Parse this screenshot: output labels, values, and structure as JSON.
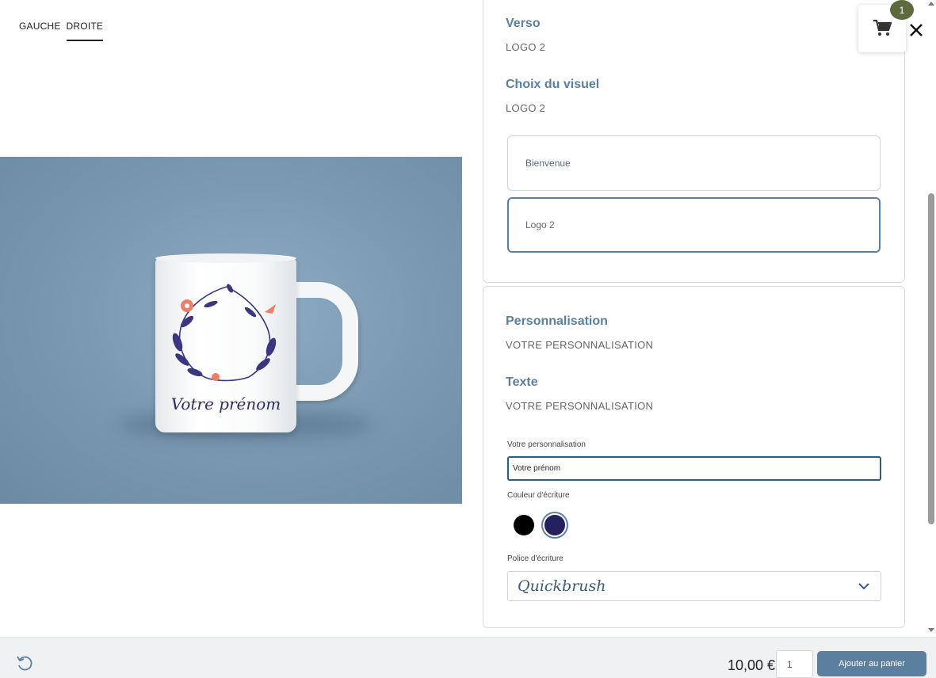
{
  "preview": {
    "tabs": [
      {
        "label": "GAUCHE",
        "active": false
      },
      {
        "label": "DROITE",
        "active": true
      }
    ],
    "mug_text": "Votre prénom",
    "background_color": "#7897b0"
  },
  "verso": {
    "title": "Verso",
    "value": "LOGO 2"
  },
  "visual": {
    "title": "Choix du visuel",
    "value": "LOGO 2",
    "options": [
      {
        "label": "Bienvenue",
        "selected": false
      },
      {
        "label": "Logo 2",
        "selected": true
      }
    ]
  },
  "personalisation": {
    "title": "Personnalisation",
    "value": "VOTRE PERSONNALISATION"
  },
  "text": {
    "title": "Texte",
    "value": "VOTRE PERSONNALISATION",
    "input_label": "Votre personnalisation",
    "input_value": "Votre prénom",
    "color_label": "Couleur d'écriture",
    "colors": [
      {
        "name": "black",
        "hex": "#000000",
        "selected": false
      },
      {
        "name": "navy",
        "hex": "#25205e",
        "selected": true
      }
    ],
    "font_label": "Police d'écriture",
    "font_value": "Quickbrush"
  },
  "cart": {
    "count": "1"
  },
  "footer": {
    "price": "10,00 €",
    "quantity": "1",
    "add_label": "Ajouter au panier"
  },
  "colors": {
    "accent": "#5b7f9f",
    "badge": "#5d6a3e"
  }
}
